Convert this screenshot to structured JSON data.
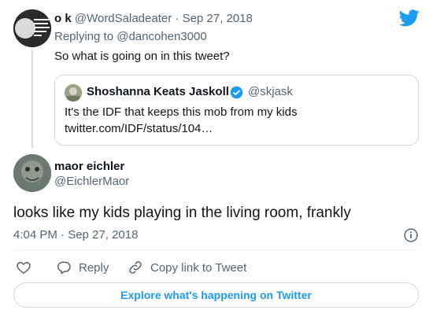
{
  "parent_tweet": {
    "display_name": "o k",
    "handle": "@WordSaladeater",
    "separator": "·",
    "date": "Sep 27, 2018",
    "replying_prefix": "Replying to",
    "replying_to": "@dancohen3000",
    "text": "So what is going on in this tweet?",
    "avatar_caption": "THE PROBLEM WITH TRYING TO FIX THE INTERNET AND BE NOT YOU"
  },
  "quoted_tweet": {
    "display_name": "Shoshanna Keats Jaskoll",
    "handle": "@skjask",
    "line1": "It's the IDF that keeps this mob from my kids",
    "line2": "twitter.com/IDF/status/104…"
  },
  "main_tweet": {
    "display_name": "maor eichler",
    "handle": "@EichlerMaor",
    "text": "looks like my kids playing in the living room, frankly",
    "timestamp": "4:04 PM · Sep 27, 2018"
  },
  "actions": {
    "reply_label": "Reply",
    "copy_label": "Copy link to Tweet"
  },
  "footer": {
    "explore_label": "Explore what's happening on Twitter"
  },
  "colors": {
    "brand": "#1d9bf0",
    "text": "#0f1419",
    "muted": "#536471",
    "border": "#cfd9de"
  },
  "icons": [
    "twitter-bird-icon",
    "verified-badge-icon",
    "info-icon",
    "heart-icon",
    "reply-icon",
    "link-icon"
  ]
}
